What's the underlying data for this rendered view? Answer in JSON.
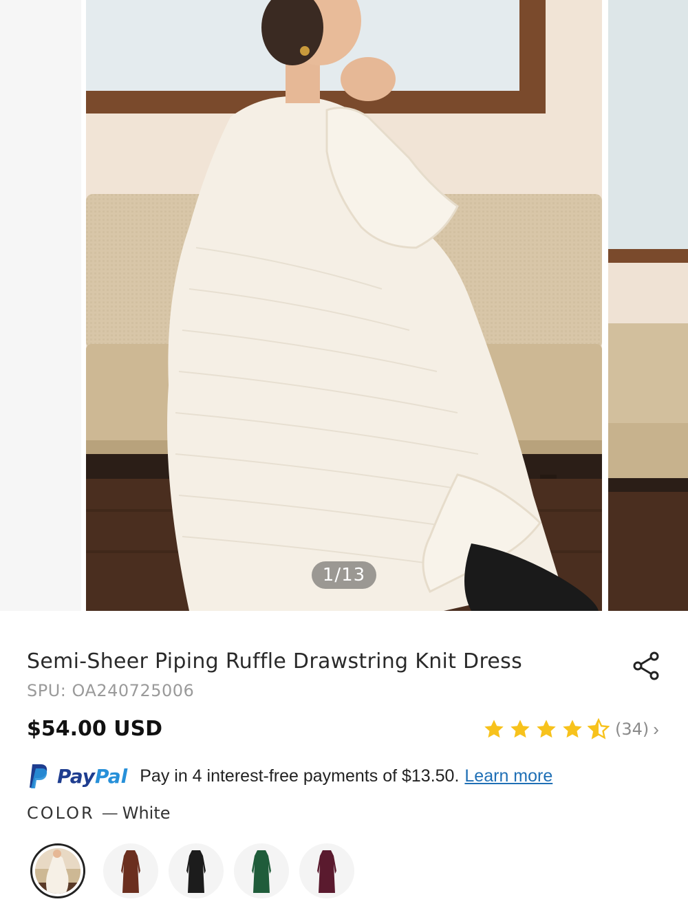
{
  "gallery": {
    "counter": "1/13"
  },
  "product": {
    "title": "Semi-Sheer Piping Ruffle Drawstring Knit Dress",
    "spu": "SPU: OA240725006",
    "price": "$54.00 USD",
    "rating": {
      "stars": 4.5,
      "count_text": "(34)",
      "chevron": "›"
    },
    "share_icon": "share-icon"
  },
  "paypal": {
    "brand_pay": "Pay",
    "brand_pal": "Pal",
    "message": "Pay in 4 interest-free payments of $13.50.",
    "learn_more": "Learn more"
  },
  "color": {
    "label": "COLOR",
    "separator": "—",
    "selected": "White",
    "options": [
      "White",
      "Brown",
      "Black",
      "Green",
      "Burgundy"
    ],
    "swatch_colors": {
      "White": "#efe8dc",
      "Brown": "#6b2f1f",
      "Black": "#1c1c1c",
      "Green": "#1f5c3a",
      "Burgundy": "#5a1a2e"
    }
  },
  "colors": {
    "star": "#f7c21c",
    "paypal_dark": "#1e3d8f",
    "paypal_light": "#2790d9",
    "link": "#1f6fb5"
  }
}
